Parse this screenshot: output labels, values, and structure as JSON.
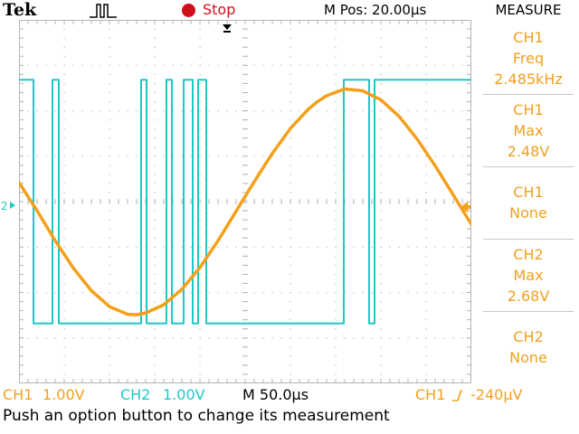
{
  "header": {
    "brand": "Tek",
    "run_state": "Stop",
    "horizontal_position": "M Pos: 20.00µs",
    "menu_title": "MEASURE"
  },
  "measurements": [
    {
      "source": "CH1",
      "type": "Freq",
      "value": "2.485kHz"
    },
    {
      "source": "CH1",
      "type": "Max",
      "value": "2.48V"
    },
    {
      "source": "CH1",
      "type": "None",
      "value": ""
    },
    {
      "source": "CH2",
      "type": "Max",
      "value": "2.68V"
    },
    {
      "source": "CH2",
      "type": "None",
      "value": ""
    }
  ],
  "status": {
    "ch1_label": "CH1",
    "ch1_scale": "1.00V",
    "ch2_label": "CH2",
    "ch2_scale": "1.00V",
    "timebase": "M 50.0µs",
    "trigger_source": "CH1",
    "trigger_level": "-240µV"
  },
  "help_text": "Push an option button to change its measurement",
  "markers": {
    "ch2_ground_marker": "2",
    "trigger_level_marker": "◂"
  },
  "colors": {
    "ch1": "#f5a01a",
    "ch2": "#1ec8c8",
    "graticule": "#b4b4b4",
    "run_indicator": "#d0101a"
  },
  "chart_data": {
    "type": "line",
    "x_unit": "µs",
    "x_range": [
      -230,
      270
    ],
    "y_range_divisions": [
      -4,
      4
    ],
    "series": [
      {
        "name": "CH1",
        "x": [
          -230,
          -210,
          -190,
          -170,
          -150,
          -130,
          -110,
          -100,
          -90,
          -70,
          -50,
          -30,
          -10,
          10,
          30,
          50,
          70,
          90,
          100,
          110,
          130,
          150,
          170,
          190,
          210,
          230,
          250,
          270
        ],
        "y": [
          0.42,
          -0.2,
          -0.86,
          -1.46,
          -1.96,
          -2.31,
          -2.48,
          -2.49,
          -2.45,
          -2.27,
          -1.93,
          -1.45,
          -0.86,
          -0.21,
          0.44,
          1.06,
          1.61,
          2.04,
          2.2,
          2.33,
          2.48,
          2.44,
          2.24,
          1.88,
          1.38,
          0.79,
          0.15,
          -0.5
        ]
      },
      {
        "name": "CH2",
        "x": [
          -230,
          -214,
          -214,
          -193,
          -193,
          -186,
          -186,
          -95,
          -95,
          -89,
          -89,
          -67,
          -67,
          -61,
          -61,
          -48,
          -48,
          -38,
          -38,
          -32,
          -32,
          -23,
          -23,
          129,
          129,
          157,
          157,
          163,
          163,
          270
        ],
        "y": [
          2.68,
          2.68,
          -2.68,
          -2.68,
          2.68,
          2.68,
          -2.68,
          -2.68,
          2.68,
          2.68,
          -2.68,
          -2.68,
          2.68,
          2.68,
          -2.68,
          -2.68,
          2.68,
          2.68,
          -2.68,
          -2.68,
          2.68,
          2.68,
          -2.68,
          -2.68,
          2.68,
          2.68,
          -2.68,
          -2.68,
          2.68,
          2.68
        ]
      }
    ]
  }
}
